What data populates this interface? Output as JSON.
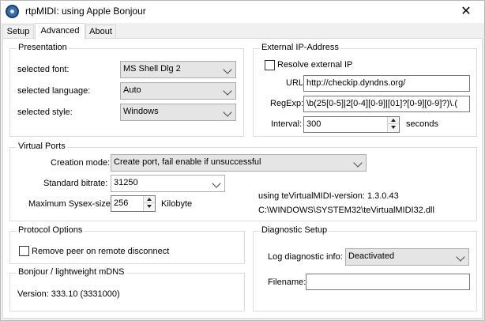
{
  "window": {
    "title": "rtpMIDI: using Apple Bonjour",
    "close_glyph": "✕"
  },
  "tabs": [
    {
      "label": "Setup",
      "active": false
    },
    {
      "label": "Advanced",
      "active": true
    },
    {
      "label": "About",
      "active": false
    }
  ],
  "presentation": {
    "title": "Presentation",
    "font_label": "selected font:",
    "font_value": "MS Shell Dlg 2",
    "language_label": "selected language:",
    "language_value": "Auto",
    "style_label": "selected style:",
    "style_value": "Windows"
  },
  "external_ip": {
    "title": "External IP-Address",
    "resolve_label": "Resolve external IP",
    "resolve_checked": false,
    "url_label": "URL:",
    "url_value": "http://checkip.dyndns.org/",
    "regexp_label": "RegExp:",
    "regexp_value": "\\b(25[0-5]|2[0-4][0-9]|[01]?[0-9][0-9]?)\\.(",
    "interval_label": "Interval:",
    "interval_value": "300",
    "interval_unit": "seconds"
  },
  "virtual_ports": {
    "title": "Virtual Ports",
    "creation_label": "Creation mode:",
    "creation_value": "Create port, fail enable if unsuccessful",
    "bitrate_label": "Standard bitrate:",
    "bitrate_value": "31250",
    "sysex_label": "Maximum Sysex-size:",
    "sysex_value": "256",
    "sysex_unit": "Kilobyte",
    "version_text": "using teVirtualMIDI-version: 1.3.0.43",
    "dll_path": "C:\\WINDOWS\\SYSTEM32\\teVirtualMIDI32.dll"
  },
  "protocol_options": {
    "title": "Protocol Options",
    "remove_peer_label": "Remove peer on remote disconnect",
    "remove_peer_checked": false
  },
  "bonjour": {
    "title": "Bonjour / lightweight mDNS",
    "version_text": "Version: 333.10 (3331000)"
  },
  "diagnostic": {
    "title": "Diagnostic Setup",
    "log_label": "Log diagnostic info:",
    "log_value": "Deactivated",
    "filename_label": "Filename:",
    "filename_value": ""
  }
}
